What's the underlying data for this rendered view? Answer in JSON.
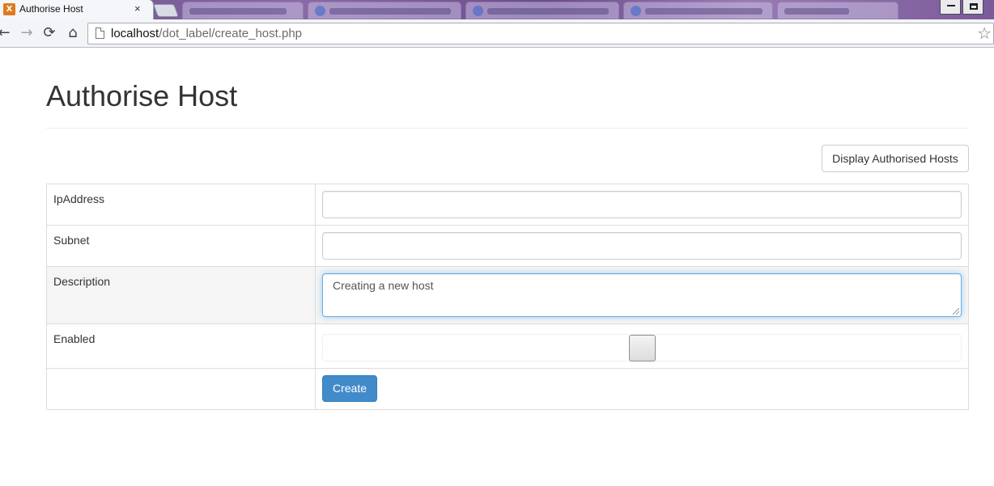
{
  "browser": {
    "active_tab": {
      "title": "Authorise Host",
      "favicon": "xampp-icon",
      "close_icon": "×"
    },
    "url": {
      "host": "localhost",
      "path": "/dot_label/create_host.php"
    },
    "icons": {
      "back": "←",
      "forward": "→",
      "reload": "⟳",
      "home": "⌂",
      "bookmark": "☆"
    }
  },
  "page": {
    "title": "Authorise Host",
    "display_button": "Display Authorised Hosts",
    "form": {
      "ip_label": "IpAddress",
      "ip_value": "",
      "subnet_label": "Subnet",
      "subnet_value": "",
      "description_label": "Description",
      "description_value": "Creating a new host",
      "enabled_label": "Enabled",
      "enabled_checked": false,
      "submit_label": "Create"
    }
  },
  "colors": {
    "primary": "#428bca",
    "focus_border": "#66afe9",
    "title_text": "#333333",
    "table_border": "#dddddd",
    "shaded_row": "#f5f5f5"
  }
}
